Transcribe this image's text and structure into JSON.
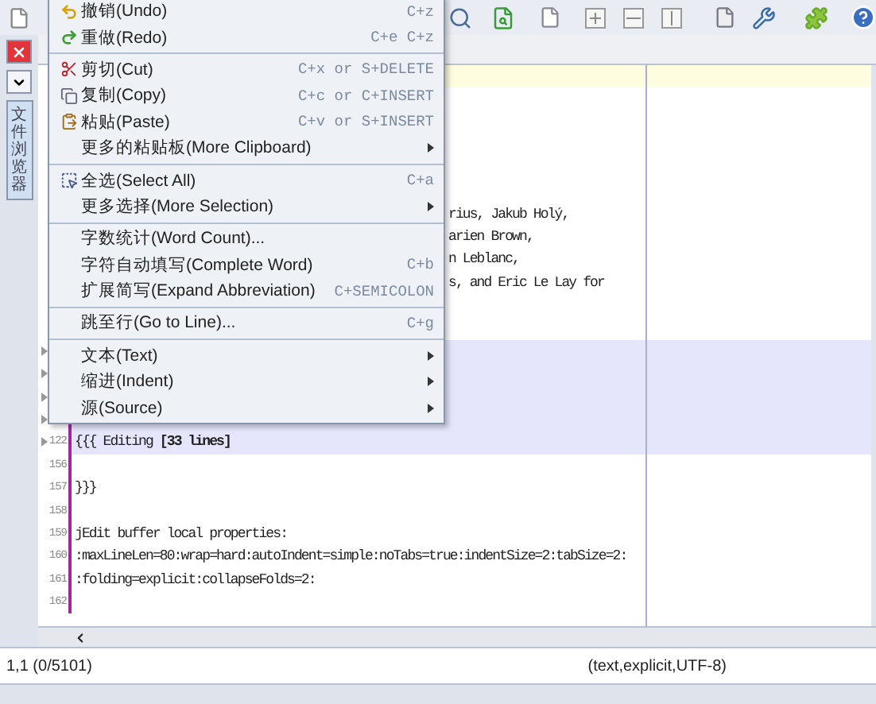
{
  "dock": {
    "tab_label": "文件浏览器"
  },
  "editor": {
    "lines": [
      {
        "current": true,
        "highlighted": false
      },
      {
        "current": false,
        "highlighted": false
      },
      {
        "current": false,
        "highlighted": false
      },
      {
        "current": false,
        "highlighted": false
      },
      {
        "current": false,
        "highlighted": false
      },
      {
        "current": false,
        "highlighted": false
      },
      {
        "kind": "tail",
        "text": "rius, Jakub Holý,",
        "current": false,
        "highlighted": false
      },
      {
        "kind": "tail",
        "text": "arien Brown,",
        "current": false,
        "highlighted": false
      },
      {
        "kind": "tail",
        "text": "n Leblanc,",
        "current": false,
        "highlighted": false
      },
      {
        "kind": "tail",
        "text": "s, and Eric Le Lay for",
        "current": false,
        "highlighted": false
      },
      {
        "current": false,
        "highlighted": false
      },
      {
        "current": false,
        "highlighted": false
      },
      {
        "current": false,
        "highlighted": true,
        "fold": true
      },
      {
        "current": false,
        "highlighted": true,
        "fold": true
      },
      {
        "current": false,
        "highlighted": true,
        "fold": true
      },
      {
        "current": false,
        "highlighted": true,
        "fold": true
      },
      {
        "kind": "code",
        "number": "122",
        "text": "{{{ Editing **[33 lines]**",
        "current": false,
        "highlighted": true,
        "fold": true
      },
      {
        "number": "156",
        "current": false,
        "highlighted": false
      },
      {
        "kind": "code",
        "number": "157",
        "text": "}}}",
        "current": false,
        "highlighted": false
      },
      {
        "number": "158",
        "current": false,
        "highlighted": false
      },
      {
        "kind": "code",
        "number": "159",
        "text": "jEdit buffer local properties:",
        "current": false,
        "highlighted": false
      },
      {
        "kind": "code",
        "number": "160",
        "text": ":maxLineLen=80:wrap=hard:autoIndent=simple:noTabs=true:indentSize=2:tabSize=2:",
        "current": false,
        "highlighted": false
      },
      {
        "kind": "code",
        "number": "161",
        "text": ":folding=explicit:collapseFolds=2:",
        "current": false,
        "highlighted": false
      },
      {
        "number": "162",
        "current": false,
        "highlighted": false
      }
    ]
  },
  "menu": {
    "items": [
      {
        "kind": "item",
        "label": "撤销(Undo)",
        "shortcut": "C+z"
      },
      {
        "kind": "item",
        "label": "重做(Redo)",
        "shortcut": "C+e C+z"
      },
      {
        "kind": "separator"
      },
      {
        "kind": "item",
        "label": "剪切(Cut)",
        "shortcut": "C+x or S+DELETE"
      },
      {
        "kind": "item",
        "label": "复制(Copy)",
        "shortcut": "C+c or C+INSERT"
      },
      {
        "kind": "item",
        "label": "粘贴(Paste)",
        "shortcut": "C+v or S+INSERT"
      },
      {
        "kind": "submenu",
        "label": "更多的粘贴板(More Clipboard)"
      },
      {
        "kind": "separator"
      },
      {
        "kind": "item",
        "label": "全选(Select All)",
        "shortcut": "C+a"
      },
      {
        "kind": "submenu",
        "label": "更多选择(More Selection)"
      },
      {
        "kind": "separator"
      },
      {
        "kind": "item",
        "label": "字数统计(Word Count)..."
      },
      {
        "kind": "item",
        "label": "字符自动填写(Complete Word)",
        "shortcut": "C+b"
      },
      {
        "kind": "item",
        "label": "扩展简写(Expand Abbreviation)",
        "shortcut": "C+SEMICOLON"
      },
      {
        "kind": "separator"
      },
      {
        "kind": "item",
        "label": "跳至行(Go to Line)...",
        "shortcut": "C+g"
      },
      {
        "kind": "separator"
      },
      {
        "kind": "submenu",
        "label": "文本(Text)"
      },
      {
        "kind": "submenu",
        "label": "缩进(Indent)"
      },
      {
        "kind": "submenu",
        "label": "源(Source)"
      }
    ]
  },
  "status_bar": {
    "position": "1,1 (0/5101)",
    "mode": "(text,explicit,UTF-8)"
  }
}
